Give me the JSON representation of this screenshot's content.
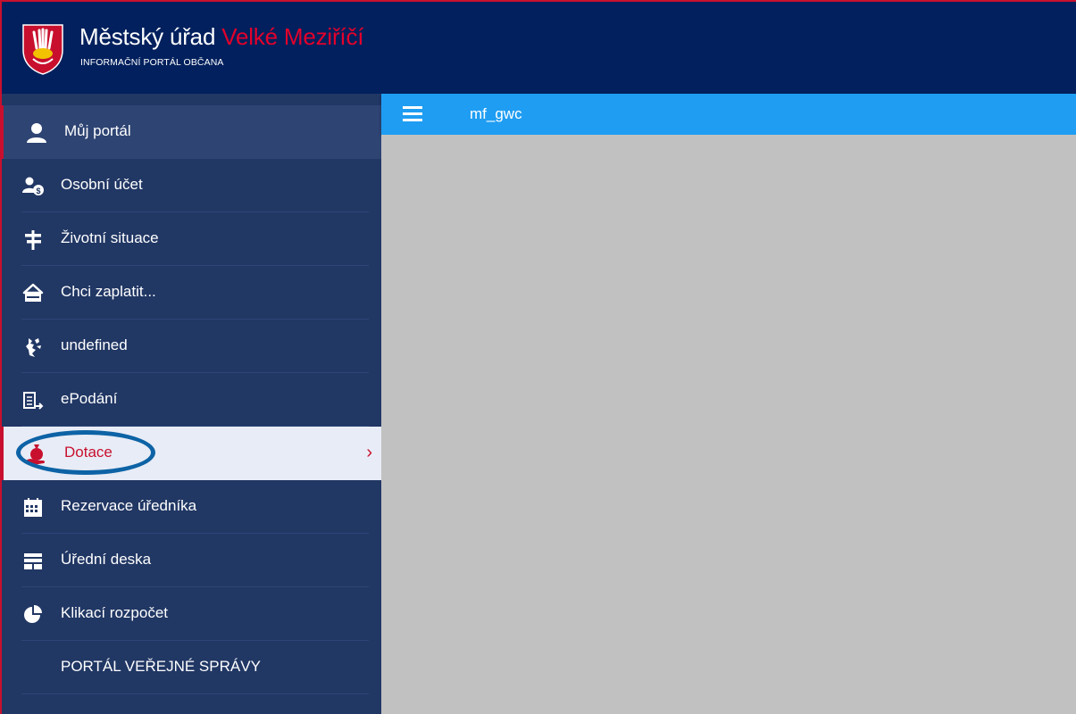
{
  "brand": {
    "title_part1": "Městský úřad ",
    "title_part2": "Velké Meziříčí",
    "subtitle": "INFORMAČNÍ PORTÁL OBČANA",
    "accent_color": "#e3002b",
    "header_bg": "#01205d"
  },
  "topbar": {
    "menu_icon": "hamburger-icon",
    "username": "mf_gwc",
    "bg_color": "#1f9df2"
  },
  "sidebar": {
    "bg_color": "#213764",
    "items": [
      {
        "label": "Můj portál",
        "icon": "user-icon"
      },
      {
        "label": "Osobní účet",
        "icon": "account-icon"
      },
      {
        "label": "Životní situace",
        "icon": "signpost-icon"
      },
      {
        "label": "Chci zaplatit...",
        "icon": "payment-icon"
      },
      {
        "label": "undefined",
        "icon": "lion-icon"
      },
      {
        "label": "ePodání",
        "icon": "submission-icon"
      },
      {
        "label": "Dotace",
        "icon": "subsidy-icon",
        "active": true
      },
      {
        "label": "Rezervace úředníka",
        "icon": "calendar-icon"
      },
      {
        "label": "Úřední deska",
        "icon": "board-icon"
      },
      {
        "label": "Klikací rozpočet",
        "icon": "pie-chart-icon"
      },
      {
        "label": "PORTÁL VEŘEJNÉ SPRÁVY",
        "icon": ""
      }
    ]
  }
}
